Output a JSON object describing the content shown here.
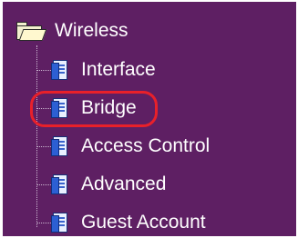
{
  "tree": {
    "root": {
      "label": "Wireless",
      "icon": "folder-open-icon"
    },
    "items": [
      {
        "label": "Interface",
        "icon": "page-icon"
      },
      {
        "label": "Bridge",
        "icon": "page-icon",
        "highlighted": true
      },
      {
        "label": "Access Control",
        "icon": "page-icon"
      },
      {
        "label": "Advanced",
        "icon": "page-icon"
      },
      {
        "label": "Guest Account",
        "icon": "page-icon"
      }
    ]
  },
  "colors": {
    "background": "#5e1f63",
    "text": "#ffffff",
    "highlight_ring": "#e8202a",
    "page_icon_blue": "#2c5fd3"
  }
}
